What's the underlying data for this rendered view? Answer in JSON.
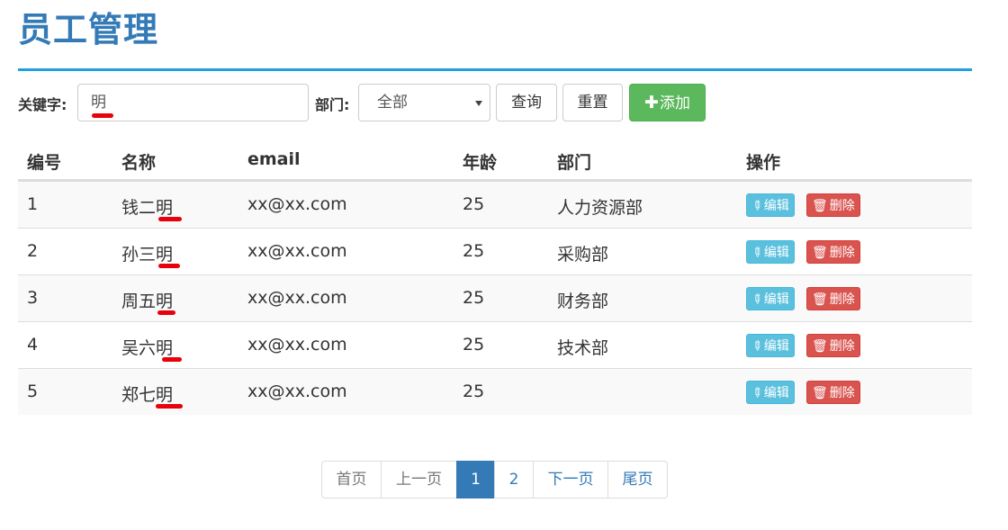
{
  "page": {
    "title": "员工管理"
  },
  "search": {
    "keyword_label": "关键字:",
    "keyword_value": "明",
    "dept_label": "部门:",
    "dept_selected": "全部",
    "query_label": "查询",
    "reset_label": "重置",
    "add_label": "添加"
  },
  "table": {
    "headers": [
      "编号",
      "名称",
      "email",
      "年龄",
      "部门",
      "操作"
    ],
    "rows": [
      {
        "id": "1",
        "name": "钱二明",
        "email": "xx@xx.com",
        "age": "25",
        "dept": "人力资源部"
      },
      {
        "id": "2",
        "name": "孙三明",
        "email": "xx@xx.com",
        "age": "25",
        "dept": "采购部"
      },
      {
        "id": "3",
        "name": "周五明",
        "email": "xx@xx.com",
        "age": "25",
        "dept": "财务部"
      },
      {
        "id": "4",
        "name": "吴六明",
        "email": "xx@xx.com",
        "age": "25",
        "dept": "技术部"
      },
      {
        "id": "5",
        "name": "郑七明",
        "email": "xx@xx.com",
        "age": "25",
        "dept": ""
      }
    ],
    "edit_label": "编辑",
    "delete_label": "删除"
  },
  "pagination": {
    "first": "首页",
    "prev": "上一页",
    "pages": [
      "1",
      "2"
    ],
    "current": "1",
    "next": "下一页",
    "last": "尾页"
  },
  "colors": {
    "primary": "#337ab7",
    "title_rule": "#1f9fe0",
    "success": "#5cb85c",
    "info": "#5bc0de",
    "danger": "#d9534f",
    "highlight_mark": "#e8000b"
  },
  "icons": {
    "add": "plus-icon",
    "edit": "pencil-icon",
    "delete": "trash-icon",
    "select": "caret-down-icon"
  }
}
